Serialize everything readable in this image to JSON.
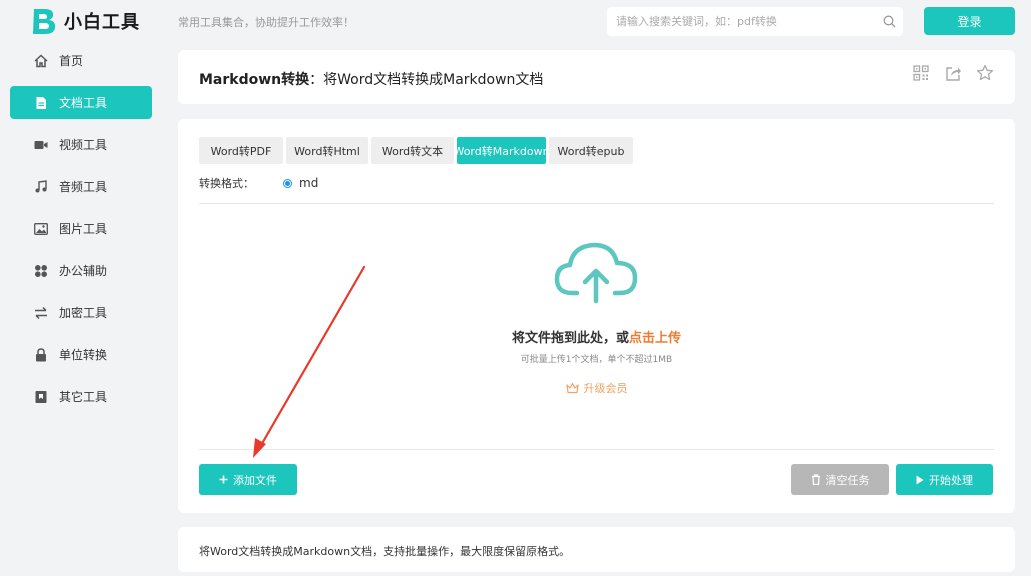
{
  "header": {
    "logo_text": "小白工具",
    "slogan": "常用工具集合，协助提升工作效率！",
    "search_placeholder": "请输入搜索关键词，如：pdf转换",
    "login_label": "登录"
  },
  "sidebar": {
    "items": [
      {
        "label": "首页",
        "icon": "home-icon",
        "active": false
      },
      {
        "label": "文档工具",
        "icon": "document-icon",
        "active": true
      },
      {
        "label": "视频工具",
        "icon": "video-icon",
        "active": false
      },
      {
        "label": "音频工具",
        "icon": "music-icon",
        "active": false
      },
      {
        "label": "图片工具",
        "icon": "image-icon",
        "active": false
      },
      {
        "label": "办公辅助",
        "icon": "apps-icon",
        "active": false
      },
      {
        "label": "加密工具",
        "icon": "swap-icon",
        "active": false
      },
      {
        "label": "单位转换",
        "icon": "lock-icon",
        "active": false
      },
      {
        "label": "其它工具",
        "icon": "bookmark-icon",
        "active": false
      }
    ]
  },
  "title_card": {
    "title_bold": "Markdown转换",
    "title_rest": "：将Word文档转换成Markdown文档"
  },
  "tabs": [
    {
      "label": "Word转PDF",
      "active": false
    },
    {
      "label": "Word转Html",
      "active": false
    },
    {
      "label": "Word转文本",
      "active": false
    },
    {
      "label": "Word转Markdown",
      "active": true
    },
    {
      "label": "Word转epub",
      "active": false
    }
  ],
  "format": {
    "label": "转换格式：",
    "value": "md"
  },
  "upload": {
    "text_main": "将文件拖到此处，或",
    "text_link": "点击上传",
    "hint": "可批量上传1个文档，单个不超过1MB",
    "upgrade": "升级会员"
  },
  "actions": {
    "add": "添加文件",
    "clear": "清空任务",
    "start": "开始处理"
  },
  "description": "将Word文档转换成Markdown文档，支持批量操作，最大限度保留原格式。",
  "colors": {
    "accent": "#1cc6bd",
    "link": "#f07c33",
    "arrow": "#e8392b"
  }
}
